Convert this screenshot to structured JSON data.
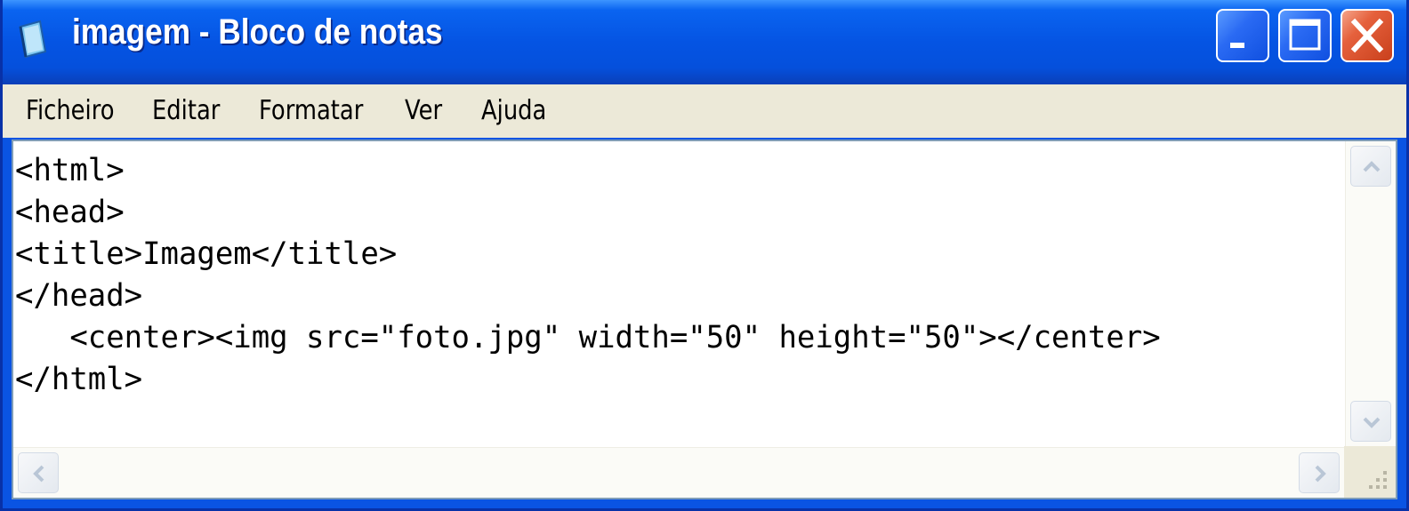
{
  "window": {
    "title": "imagem - Bloco de notas",
    "icon": "notepad-icon",
    "buttons": {
      "minimize": "minimize-icon",
      "maximize": "maximize-icon",
      "close": "close-icon"
    }
  },
  "menu": {
    "items": [
      {
        "label": "Ficheiro"
      },
      {
        "label": "Editar"
      },
      {
        "label": "Formatar"
      },
      {
        "label": "Ver"
      },
      {
        "label": "Ajuda"
      }
    ]
  },
  "document": {
    "lines": [
      "<html>",
      "<head>",
      "<title>Imagem</title>",
      "</head>",
      "   <center><img src=\"foto.jpg\" width=\"50\" height=\"50\"></center>",
      "</html>"
    ]
  },
  "colors": {
    "titlebar": "#0554e3",
    "menubar": "#ece9d8",
    "close_button": "#c9401c"
  }
}
